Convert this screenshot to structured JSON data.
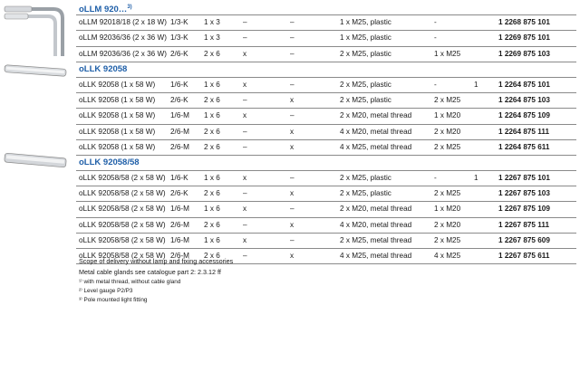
{
  "sections": [
    {
      "title": "oLLM 920…",
      "title_sup": "3)",
      "rows": [
        [
          "oLLM 92018/18 (2 x 18 W)",
          "1/3-K",
          "1 x 3",
          "–",
          "–",
          "1 x M25, plastic",
          "-",
          "",
          "1 2268 875 101"
        ],
        [
          "oLLM 92036/36 (2 x 36 W)",
          "1/3-K",
          "1 x 3",
          "–",
          "–",
          "1 x M25, plastic",
          "-",
          "",
          "1 2269 875 101"
        ],
        [
          "oLLM 92036/36 (2 x 36 W)",
          "2/6-K",
          "2 x 6",
          "x",
          "–",
          "2 x M25, plastic",
          "1 x M25",
          "",
          "1 2269 875 103"
        ]
      ]
    },
    {
      "title": "oLLK 92058",
      "title_sup": "",
      "rows": [
        [
          "oLLK 92058 (1 x 58 W)",
          "1/6-K",
          "1 x 6",
          "x",
          "–",
          "2 x M25, plastic",
          "-",
          "1",
          "1 2264 875 101"
        ],
        [
          "oLLK 92058 (1 x 58 W)",
          "2/6-K",
          "2 x 6",
          "–",
          "x",
          "2 x M25, plastic",
          "2 x M25",
          "",
          "1 2264 875 103"
        ],
        [
          "oLLK 92058 (1 x 58 W)",
          "1/6-M",
          "1 x 6",
          "x",
          "–",
          "2 x M20, metal thread",
          "1 x M20",
          "",
          "1 2264 875 109"
        ],
        [
          "oLLK 92058 (1 x 58 W)",
          "2/6-M",
          "2 x 6",
          "–",
          "x",
          "4 x M20, metal thread",
          "2 x M20",
          "",
          "1 2264 875 111"
        ],
        [
          "oLLK 92058 (1 x 58 W)",
          "2/6-M",
          "2 x 6",
          "–",
          "x",
          "4 x M25, metal thread",
          "2 x M25",
          "",
          "1 2264 875 611"
        ]
      ]
    },
    {
      "title": "oLLK 92058/58",
      "title_sup": "",
      "rows": [
        [
          "oLLK 92058/58 (2 x 58 W)",
          "1/6-K",
          "1 x 6",
          "x",
          "–",
          "2 x M25, plastic",
          "-",
          "1",
          "1 2267 875 101"
        ],
        [
          "oLLK 92058/58 (2 x 58 W)",
          "2/6-K",
          "2 x 6",
          "–",
          "x",
          "2 x M25, plastic",
          "2 x M25",
          "",
          "1 2267 875 103"
        ],
        [
          "oLLK 92058/58 (2 x 58 W)",
          "1/6-M",
          "1 x 6",
          "x",
          "–",
          "2 x M20, metal thread",
          "1 x M20",
          "",
          "1 2267 875 109"
        ],
        [
          "oLLK 92058/58 (2 x 58 W)",
          "2/6-M",
          "2 x 6",
          "–",
          "x",
          "4 x M20, metal thread",
          "2 x M20",
          "",
          "1 2267 875 111"
        ],
        [
          "oLLK 92058/58 (2 x 58 W)",
          "1/6-M",
          "1 x 6",
          "x",
          "–",
          "2 x M25, metal thread",
          "2 x M25",
          "",
          "1 2267 875 609"
        ],
        [
          "oLLK 92058/58 (2 x 58 W)",
          "2/6-M",
          "2 x 6",
          "–",
          "x",
          "4 x M25, metal thread",
          "4 x M25",
          "",
          "1 2267 875 611"
        ]
      ]
    }
  ],
  "notes": {
    "scope": "Scope of delivery without lamp and fixing accessories",
    "glands": "Metal cable glands see catalogue part 2: 2.3.12 ff",
    "fn1": "¹⁾ with metal thread, without cable gland",
    "fn2": "²⁾ Level gauge P2/P3",
    "fn3": "³⁾ Pole mounted light fitting"
  },
  "colors": {
    "heading": "#1f5fa8",
    "rule": "#8a8a8a"
  }
}
